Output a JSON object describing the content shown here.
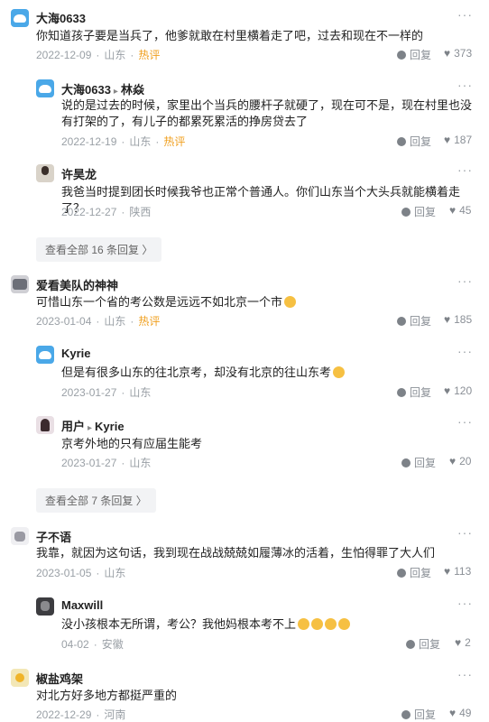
{
  "comments": [
    {
      "id": "c1",
      "user": "大海0633",
      "text": "你知道孩子要是当兵了，他爹就敢在村里横着走了吧，过去和现在不一样的",
      "date": "2022-12-09",
      "loc": "山东",
      "hot": "热评",
      "reply": "回复",
      "likes": "373"
    },
    {
      "id": "c1r1",
      "user": "大海0633",
      "reply_to": "林焱",
      "text": "说的是过去的时候，家里出个当兵的腰杆子就硬了，现在可不是，现在村里也没有打架的了，有儿子的都累死累活的挣房贷去了",
      "date": "2022-12-19",
      "loc": "山东",
      "hot": "热评",
      "reply": "回复",
      "likes": "187"
    },
    {
      "id": "c1r2",
      "user": "许昊龙",
      "text": "我爸当时提到团长时候我爷也正常个普通人。你们山东当个大头兵就能横着走了？",
      "date": "2022-12-27",
      "loc": "陕西",
      "reply": "回复",
      "likes": "45"
    },
    {
      "id": "c2",
      "user": "爱看美队的神神",
      "text": "可惜山东一个省的考公数是远远不如北京一个市",
      "date": "2023-01-04",
      "loc": "山东",
      "hot": "热评",
      "reply": "回复",
      "likes": "185"
    },
    {
      "id": "c2r1",
      "user": "Kyrie",
      "text": "但是有很多山东的往北京考，却没有北京的往山东考",
      "date": "2023-01-27",
      "loc": "山东",
      "reply": "回复",
      "likes": "120"
    },
    {
      "id": "c2r2",
      "user": "用户",
      "reply_to": "Kyrie",
      "text": "京考外地的只有应届生能考",
      "date": "2023-01-27",
      "loc": "山东",
      "reply": "回复",
      "likes": "20"
    },
    {
      "id": "c3",
      "user": "子不语",
      "text": "我靠，就因为这句话，我到现在战战兢兢如履薄冰的活着，生怕得罪了大人们",
      "date": "2023-01-05",
      "loc": "山东",
      "reply": "回复",
      "likes": "113"
    },
    {
      "id": "c3r1",
      "user": "Maxwill",
      "text": "没小孩根本无所谓，考公？我他妈根本考不上",
      "date": "04-02",
      "loc": "安徽",
      "reply": "回复",
      "likes": "2"
    },
    {
      "id": "c4",
      "user": "椒盐鸡架",
      "text": "对北方好多地方都挺严重的",
      "date": "2022-12-29",
      "loc": "河南",
      "reply": "回复",
      "likes": "49"
    }
  ],
  "view_all": [
    "查看全部 16 条回复",
    "查看全部 7 条回复"
  ],
  "more_icon": "···",
  "view_all_chevron": "〉",
  "reply_arrow": "▸",
  "icons": {
    "reply": "comment-bubble-icon",
    "like": "heart-icon",
    "more": "more-dots-icon",
    "emoji": "laughing-face-emoji"
  }
}
